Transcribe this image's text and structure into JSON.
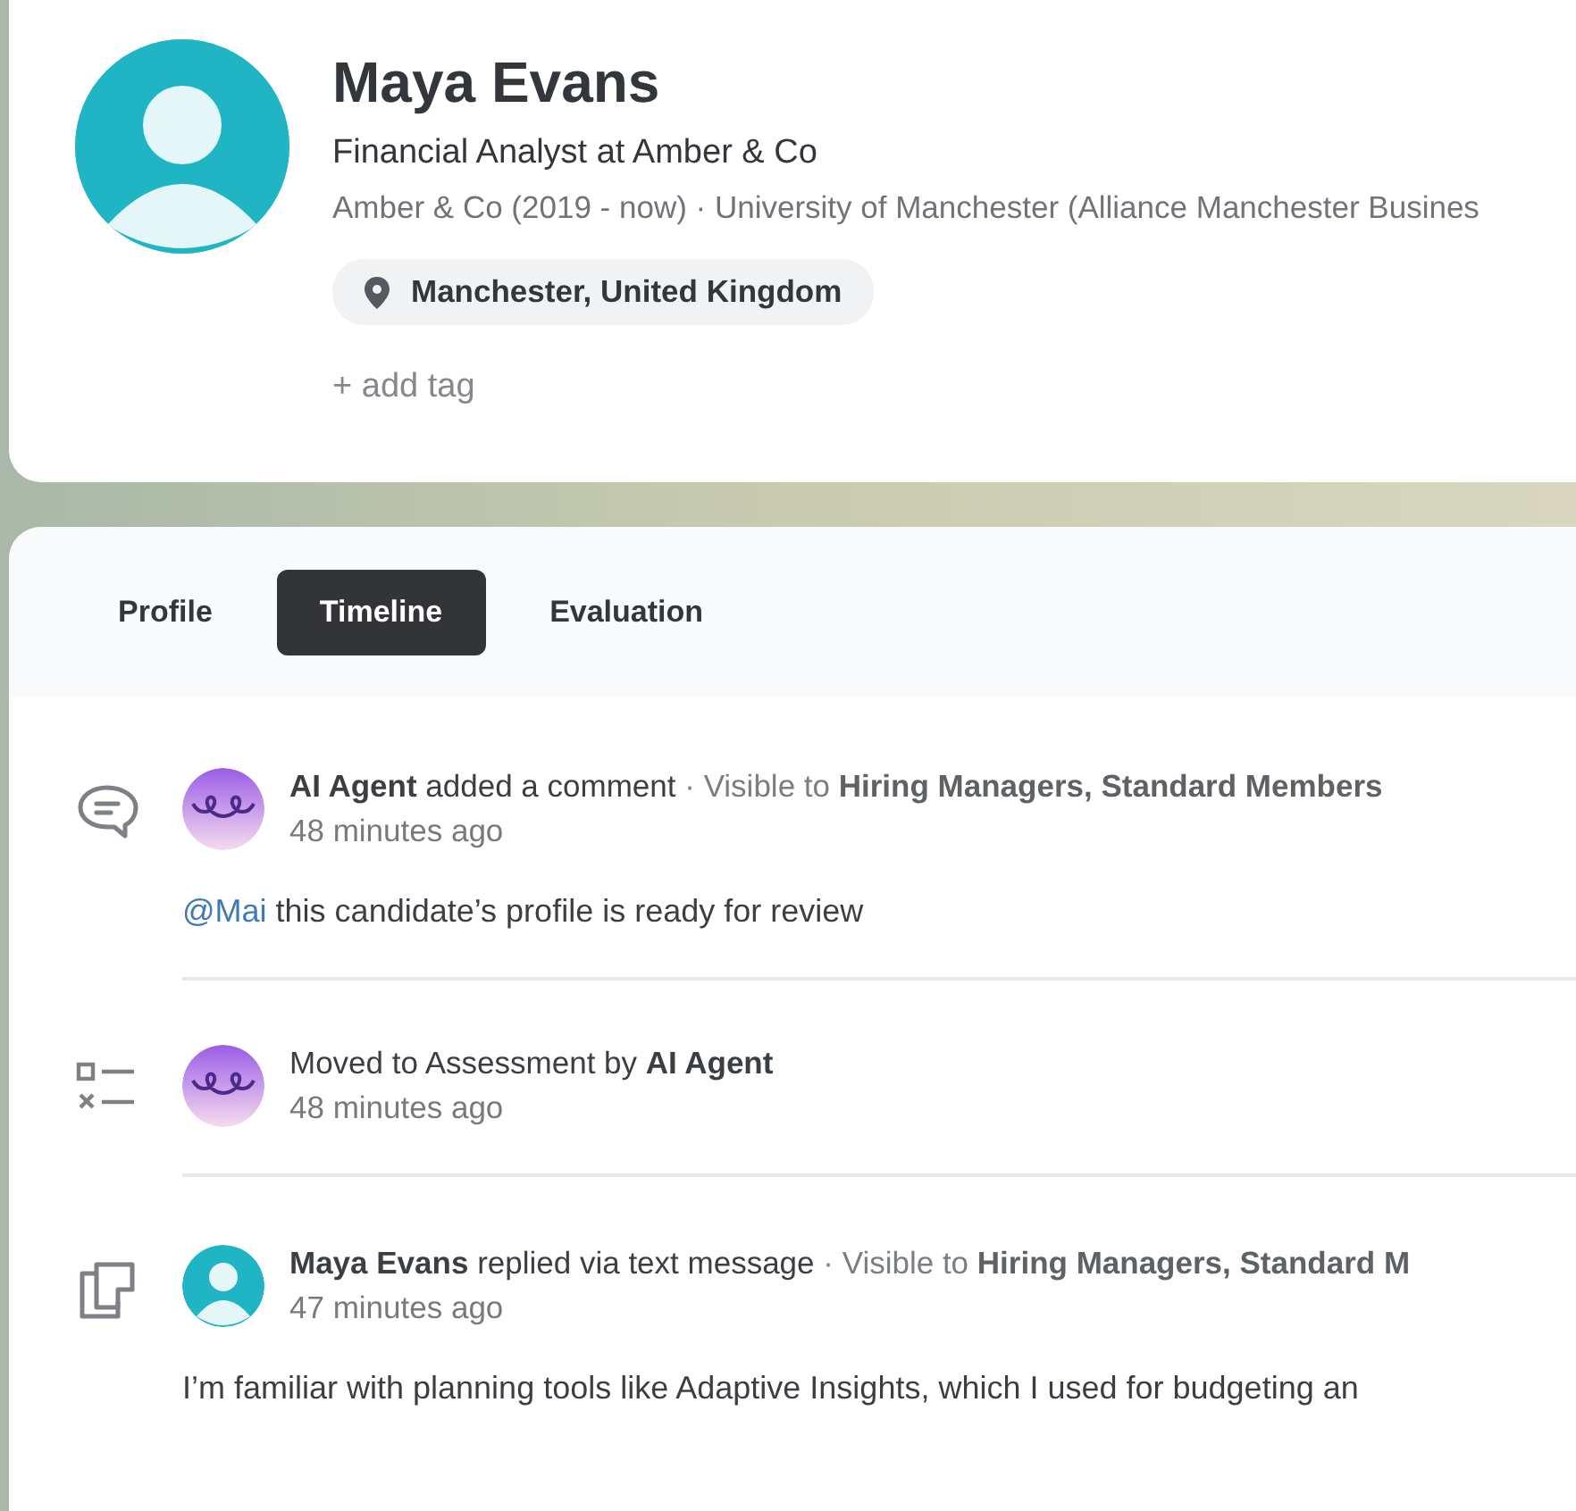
{
  "profile": {
    "name": "Maya Evans",
    "headline": "Financial Analyst at Amber & Co",
    "history": "Amber & Co (2019 - now) · University of Manchester (Alliance Manchester Busines",
    "location": "Manchester, United Kingdom",
    "add_tag": "+ add tag"
  },
  "tabs": [
    {
      "label": "Profile",
      "selected": false
    },
    {
      "label": "Timeline",
      "selected": true
    },
    {
      "label": "Evaluation",
      "selected": false
    }
  ],
  "timeline": [
    {
      "kind": "comment",
      "avatar": {
        "kind": "agent"
      },
      "headline": "**AI Agent** added a comment",
      "visibility": "· Visible to **Hiring Managers, Standard Members**",
      "time": "48 minutes ago",
      "mention": "@Mai",
      "body": "this candidate’s profile is ready for review"
    },
    {
      "kind": "status",
      "avatar": {
        "kind": "agent"
      },
      "headline": "Moved to Assessment by **AI Agent**",
      "time": "48 minutes ago"
    },
    {
      "kind": "message",
      "avatar": {
        "kind": "person"
      },
      "headline": "**Maya Evans** replied via text message",
      "visibility": "· Visible to **Hiring Managers, Standard M**",
      "time": "47 minutes ago",
      "body": "I’m familiar with planning tools like Adaptive Insights, which I used for budgeting an"
    }
  ]
}
